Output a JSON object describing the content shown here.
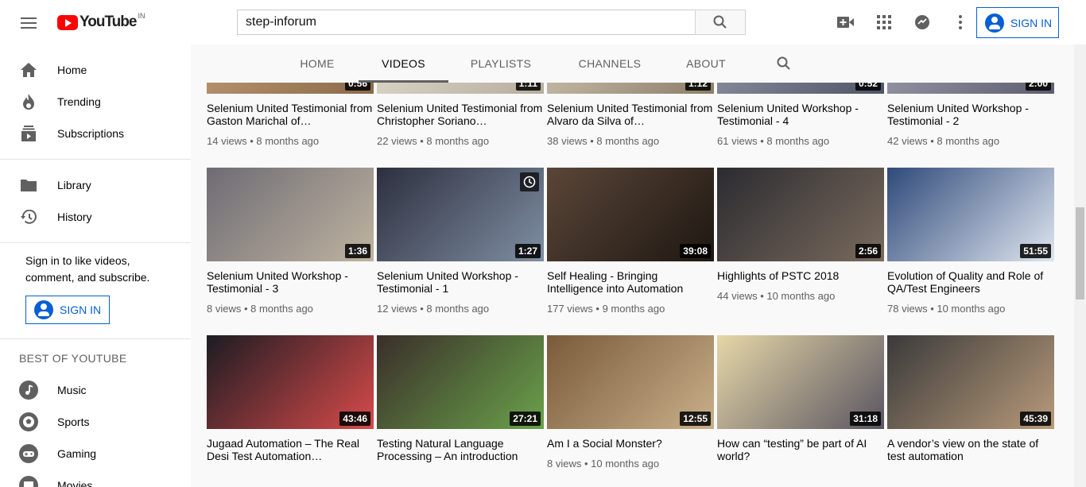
{
  "header": {
    "logo_text": "YouTube",
    "logo_country": "IN",
    "search_value": "step-inforum",
    "signin_label": "SIGN IN"
  },
  "sidebar": {
    "main_items": [
      {
        "label": "Home",
        "icon": "home-icon"
      },
      {
        "label": "Trending",
        "icon": "flame-icon"
      },
      {
        "label": "Subscriptions",
        "icon": "subscriptions-icon"
      }
    ],
    "library_items": [
      {
        "label": "Library",
        "icon": "folder-icon"
      },
      {
        "label": "History",
        "icon": "history-icon"
      }
    ],
    "signin_prompt": "Sign in to like videos, comment, and subscribe.",
    "signin_label": "SIGN IN",
    "best_heading": "BEST OF YOUTUBE",
    "best_items": [
      {
        "label": "Music",
        "icon": "music-icon"
      },
      {
        "label": "Sports",
        "icon": "sports-icon"
      },
      {
        "label": "Gaming",
        "icon": "gaming-icon"
      },
      {
        "label": "Movies",
        "icon": "movies-icon"
      }
    ]
  },
  "channel_tabs": [
    "HOME",
    "VIDEOS",
    "PLAYLISTS",
    "CHANNELS",
    "ABOUT"
  ],
  "active_tab": "VIDEOS",
  "videos": [
    {
      "title": "Selenium United Testimonial from Gaston Marichal of…",
      "meta": "14 views • 8 months ago",
      "duration": "0:56"
    },
    {
      "title": "Selenium United Testimonial from Christopher Soriano…",
      "meta": "22 views • 8 months ago",
      "duration": "1:11"
    },
    {
      "title": "Selenium United Testimonial from Alvaro da Silva of…",
      "meta": "38 views • 8 months ago",
      "duration": "1:12"
    },
    {
      "title": "Selenium United Workshop - Testimonial - 4",
      "meta": "61 views • 8 months ago",
      "duration": "0:52"
    },
    {
      "title": "Selenium United Workshop - Testimonial - 2",
      "meta": "42 views • 8 months ago",
      "duration": "2:00"
    },
    {
      "title": "Selenium United Workshop - Testimonial - 3",
      "meta": "8 views • 8 months ago",
      "duration": "1:36"
    },
    {
      "title": "Selenium United Workshop - Testimonial - 1",
      "meta": "12 views • 8 months ago",
      "duration": "1:27"
    },
    {
      "title": "Self Healing - Bringing Intelligence into Automation",
      "meta": "177 views • 9 months ago",
      "duration": "39:08"
    },
    {
      "title": "Highlights of PSTC 2018",
      "meta": "44 views • 10 months ago",
      "duration": "2:56"
    },
    {
      "title": "Evolution of Quality and Role of QA/Test Engineers",
      "meta": "78 views • 10 months ago",
      "duration": "51:55"
    },
    {
      "title": "Jugaad Automation – The Real Desi Test Automation…",
      "meta": "",
      "duration": "43:46"
    },
    {
      "title": "Testing Natural Language Processing – An introduction",
      "meta": "",
      "duration": "27:21"
    },
    {
      "title": "Am I a Social Monster?",
      "meta": "8 views • 10 months ago",
      "duration": "12:55"
    },
    {
      "title": "How can “testing” be part of AI world?",
      "meta": "",
      "duration": "31:18"
    },
    {
      "title": "A vendor’s view on the state of test automation",
      "meta": "",
      "duration": "45:39"
    }
  ],
  "colors": {
    "brand_red": "#ff0000",
    "link_blue": "#065fd4"
  }
}
